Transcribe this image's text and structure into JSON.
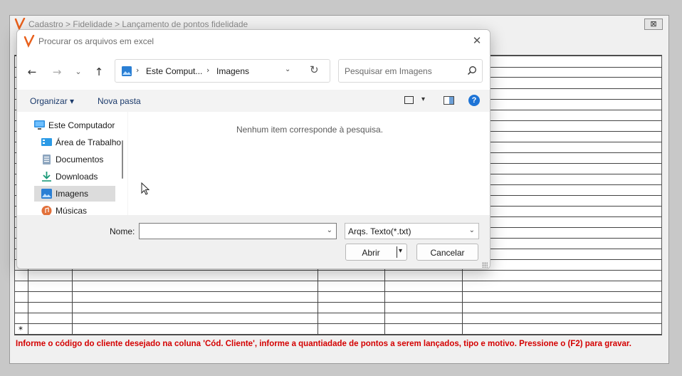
{
  "background_app": {
    "title": "Cadastro > Fidelidade > Lançamento de pontos fidelidade",
    "close_glyph": "⊠",
    "grid_last_row_marker": "*",
    "status_message": "Informe o código do cliente desejado na coluna 'Cód. Cliente', informe a quantiadade de pontos a serem lançados, tipo e motivo. Pressione o (F2) para gravar.",
    "status_color": "#d40000"
  },
  "dialog": {
    "title": "Procurar os arquivos em excel",
    "close_glyph": "✕",
    "nav": {
      "back_glyph": "←",
      "forward_glyph": "→",
      "recent_glyph": "⌄",
      "up_glyph": "↑"
    },
    "address": {
      "icon": "pictures-folder-icon",
      "sep": "›",
      "crumbs": [
        "Este Comput...",
        "Imagens"
      ],
      "dropdown_glyph": "⌄",
      "refresh_glyph": "↻"
    },
    "search": {
      "placeholder": "Pesquisar em Imagens",
      "icon": "search-icon"
    },
    "command_bar": {
      "organize": "Organizar ▾",
      "new_folder": "Nova pasta",
      "view_dropdown_glyph": "▾",
      "help_glyph": "?"
    },
    "sidebar": {
      "items": [
        {
          "label": "Este Computador",
          "icon": "computer-icon"
        },
        {
          "label": "Área de Trabalho",
          "icon": "desktop-icon"
        },
        {
          "label": "Documentos",
          "icon": "documents-icon"
        },
        {
          "label": "Downloads",
          "icon": "download-icon"
        },
        {
          "label": "Imagens",
          "icon": "pictures-icon",
          "selected": true
        },
        {
          "label": "Músicas",
          "icon": "music-icon"
        }
      ]
    },
    "content": {
      "empty_message": "Nenhum item corresponde à pesquisa."
    },
    "footer": {
      "name_label": "Nome:",
      "name_value": "",
      "dropdown_glyph": "⌄",
      "file_type": "Arqs. Texto(*.txt)",
      "open_label": "Abrir",
      "open_dropdown_glyph": "▾",
      "cancel_label": "Cancelar"
    }
  },
  "colors": {
    "accent": "#1e74d6",
    "logo": "#e8601c",
    "command_text": "#1b3a6b"
  }
}
